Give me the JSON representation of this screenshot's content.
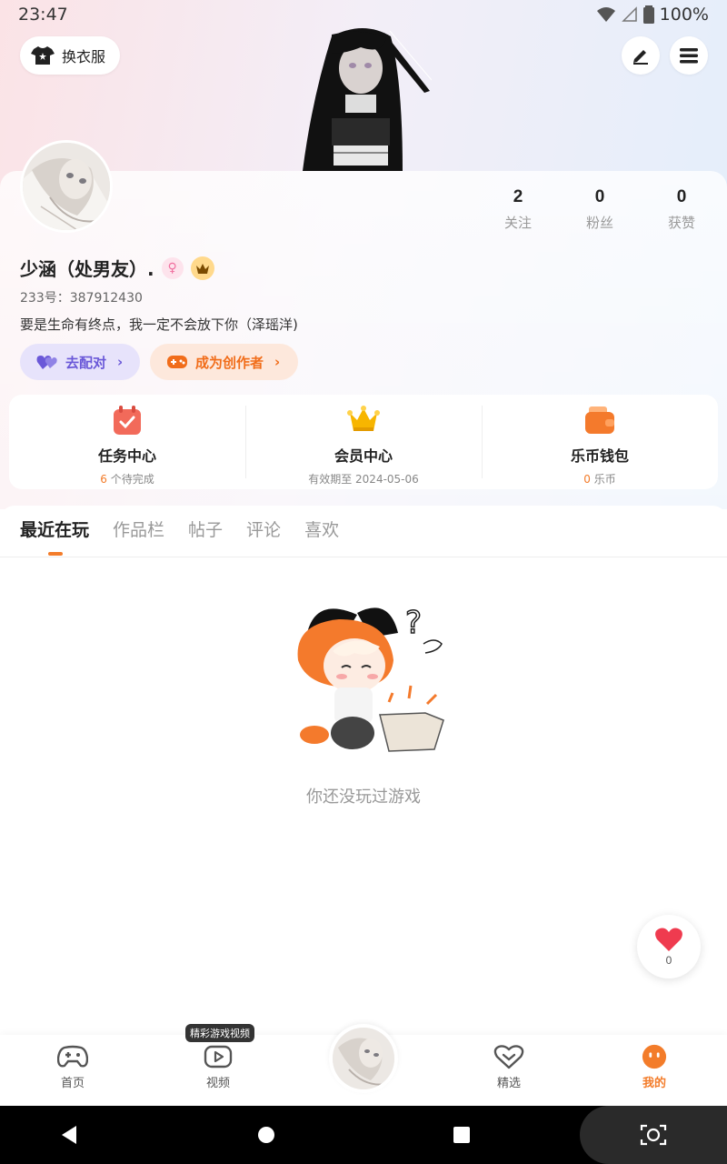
{
  "status_bar": {
    "time": "23:47",
    "battery": "100%"
  },
  "header": {
    "outfit_label": "换衣服",
    "edit_icon": "pen-icon",
    "menu_icon": "menu-icon"
  },
  "stats": [
    {
      "value": "2",
      "label": "关注"
    },
    {
      "value": "0",
      "label": "粉丝"
    },
    {
      "value": "0",
      "label": "获赞"
    }
  ],
  "user": {
    "name": "少涵（处男友）.",
    "id_line": "233号：387912430",
    "bio": "要是生命有终点，我一定不会放下你（泽瑶洋)"
  },
  "actions": {
    "match_label": "去配对",
    "creator_label": "成为创作者"
  },
  "features": [
    {
      "title": "任务中心",
      "sub_prefix": "6",
      "sub_text": " 个待完成"
    },
    {
      "title": "会员中心",
      "sub_prefix": "",
      "sub_text": "有效期至 2024-05-06"
    },
    {
      "title": "乐币钱包",
      "sub_prefix": "0",
      "sub_text": " 乐币"
    }
  ],
  "tabs": [
    "最近在玩",
    "作品栏",
    "帖子",
    "评论",
    "喜欢"
  ],
  "empty_state": {
    "text": "你还没玩过游戏"
  },
  "like_float": {
    "count": "0"
  },
  "bottom_nav": {
    "tooltip": "精彩游戏视频",
    "items": [
      {
        "label": "首页",
        "icon": "gamepad-icon"
      },
      {
        "label": "视频",
        "icon": "video-play-icon"
      },
      {
        "label": "精选",
        "icon": "heart-chat-icon"
      },
      {
        "label": "我的",
        "icon": "smile-face-icon"
      }
    ]
  },
  "colors": {
    "accent": "#f37c2a",
    "match_purple": "#6a58d8"
  }
}
